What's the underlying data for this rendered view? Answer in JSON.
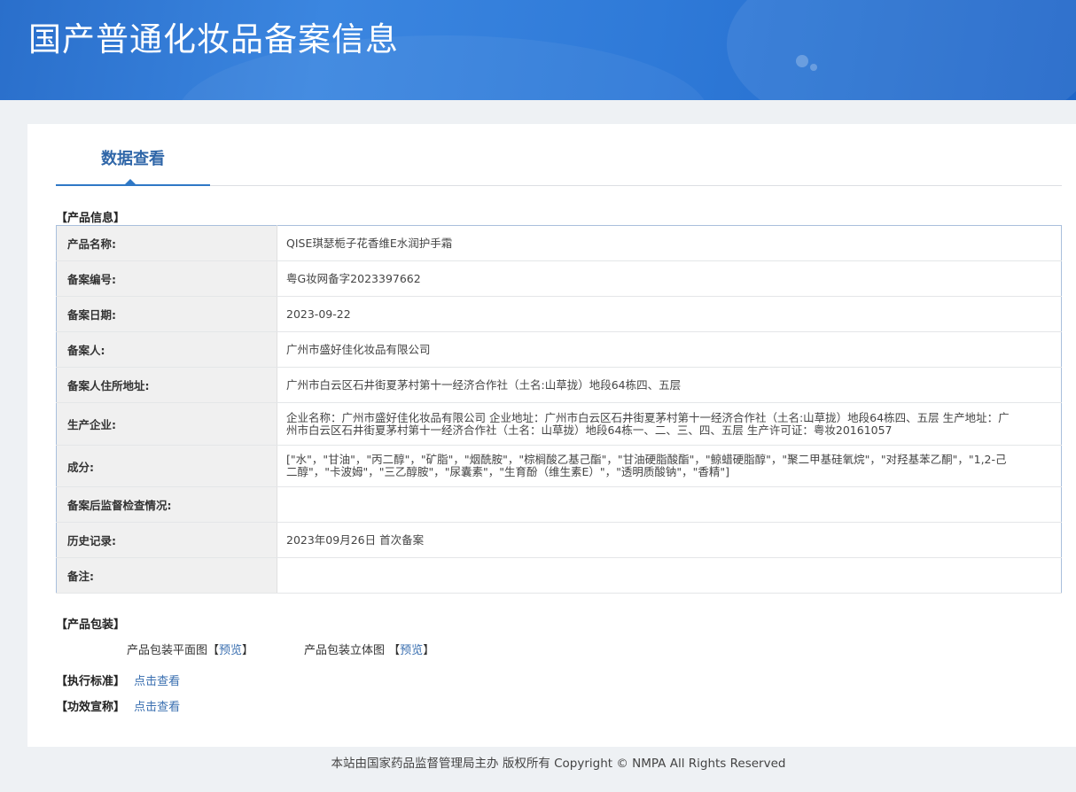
{
  "header": {
    "title": "国产普通化妆品备案信息"
  },
  "tabs": {
    "active_label": "数据查看"
  },
  "product_info": {
    "section_title": "【产品信息】",
    "rows": [
      {
        "label": "产品名称:",
        "value": "QISE琪瑟栀子花香维E水润护手霜"
      },
      {
        "label": "备案编号:",
        "value": "粤G妆网备字2023397662"
      },
      {
        "label": "备案日期:",
        "value": "2023-09-22"
      },
      {
        "label": "备案人:",
        "value": "广州市盛好佳化妆品有限公司"
      },
      {
        "label": "备案人住所地址:",
        "value": "广州市白云区石井街夏茅村第十一经济合作社（土名:山草拢）地段64栋四、五层"
      },
      {
        "label": "生产企业:",
        "value": "企业名称：广州市盛好佳化妆品有限公司 企业地址：广州市白云区石井街夏茅村第十一经济合作社（土名:山草拢）地段64栋四、五层 生产地址：广州市白云区石井街夏茅村第十一经济合作社（土名：山草拢）地段64栋一、二、三、四、五层 生产许可证：粤妆20161057"
      },
      {
        "label": "成分:",
        "value": "[\"水\"，\"甘油\"，\"丙二醇\"，\"矿脂\"，\"烟酰胺\"，\"棕榈酸乙基己酯\"，\"甘油硬脂酸酯\"，\"鲸蜡硬脂醇\"，\"聚二甲基硅氧烷\"，\"对羟基苯乙酮\"，\"1,2-己二醇\"，\"卡波姆\"，\"三乙醇胺\"，\"尿囊素\"，\"生育酚（维生素E）\"，\"透明质酸钠\"，\"香精\"]"
      },
      {
        "label": "备案后监督检查情况:",
        "value": ""
      },
      {
        "label": "历史记录:",
        "value": "2023年09月26日 首次备案"
      },
      {
        "label": "备注:",
        "value": ""
      }
    ]
  },
  "packaging": {
    "section_title": "【产品包装】",
    "flat_label": "产品包装平面图",
    "flat_link": "预览",
    "solid_label": "产品包装立体图",
    "solid_link": "预览",
    "bracket_open": "【",
    "bracket_close": "】"
  },
  "standard": {
    "section_title": "【执行标准】",
    "link": "点击查看"
  },
  "efficacy": {
    "section_title": "【功效宣称】",
    "link": "点击查看"
  },
  "footer": {
    "text": "本站由国家药品监督管理局主办 版权所有 Copyright © NMPA All Rights Reserved"
  }
}
